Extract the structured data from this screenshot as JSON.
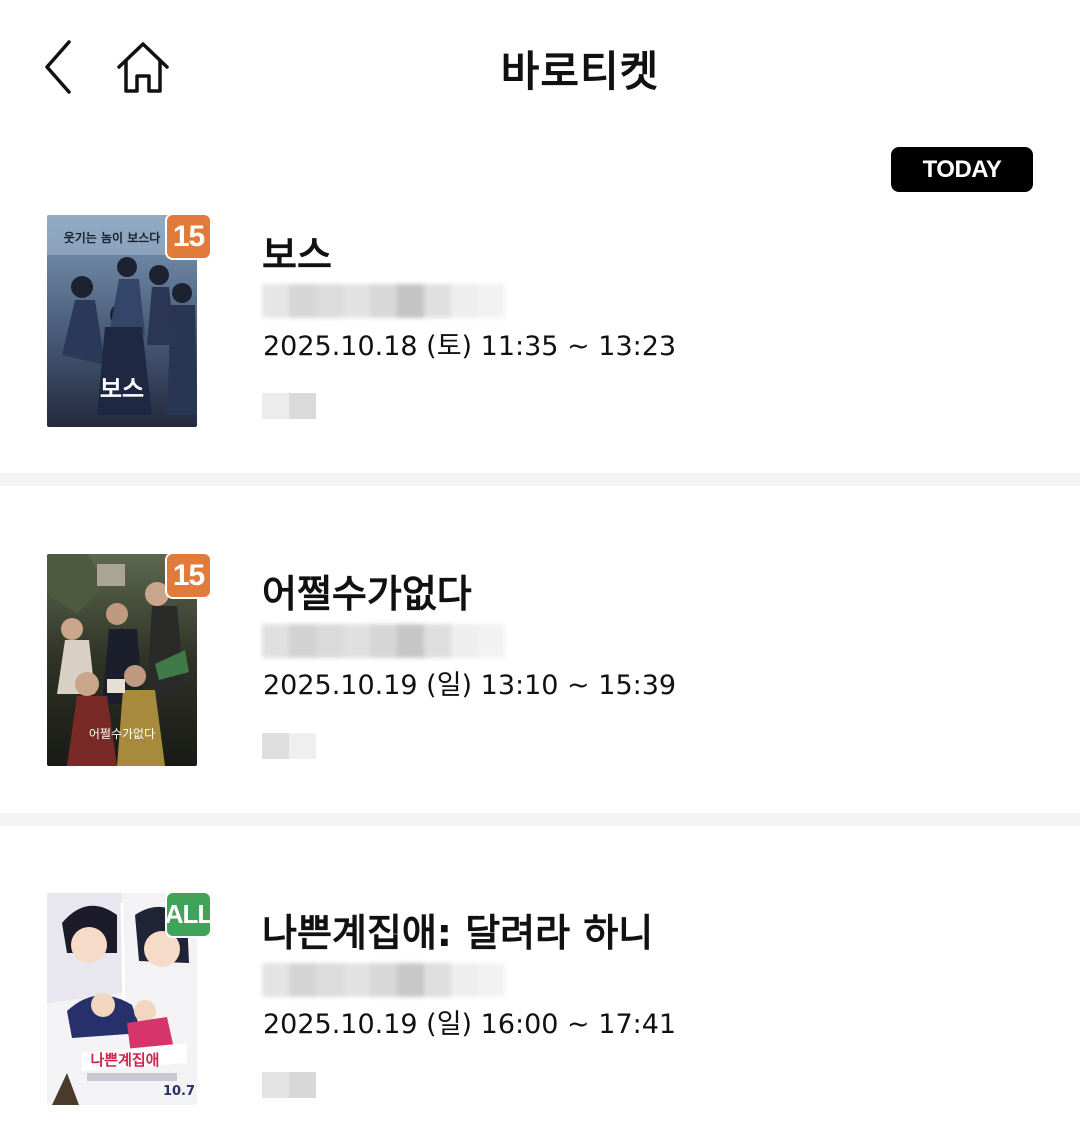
{
  "header": {
    "title": "바로티켓",
    "back_icon": "chevron-left-icon",
    "home_icon": "home-icon"
  },
  "today_badge": "TODAY",
  "tickets": [
    {
      "title": "보스",
      "datetime": "2025.10.18 (토) 11:35 ~ 13:23",
      "rating": "15",
      "rating_color": "#e07b3c",
      "poster_text": "보스",
      "poster_tagline": "웃기는 놈이 보스다"
    },
    {
      "title": "어쩔수가없다",
      "datetime": "2025.10.19 (일) 13:10 ~ 15:39",
      "rating": "15",
      "rating_color": "#e07b3c",
      "poster_text": "어쩔수가없다"
    },
    {
      "title": "나쁜계집애: 달려라 하니",
      "datetime": "2025.10.19 (일) 16:00 ~ 17:41",
      "rating": "ALL",
      "rating_color": "#3fa35a",
      "poster_text": "나쁜계집애",
      "poster_release": "10.7"
    }
  ]
}
